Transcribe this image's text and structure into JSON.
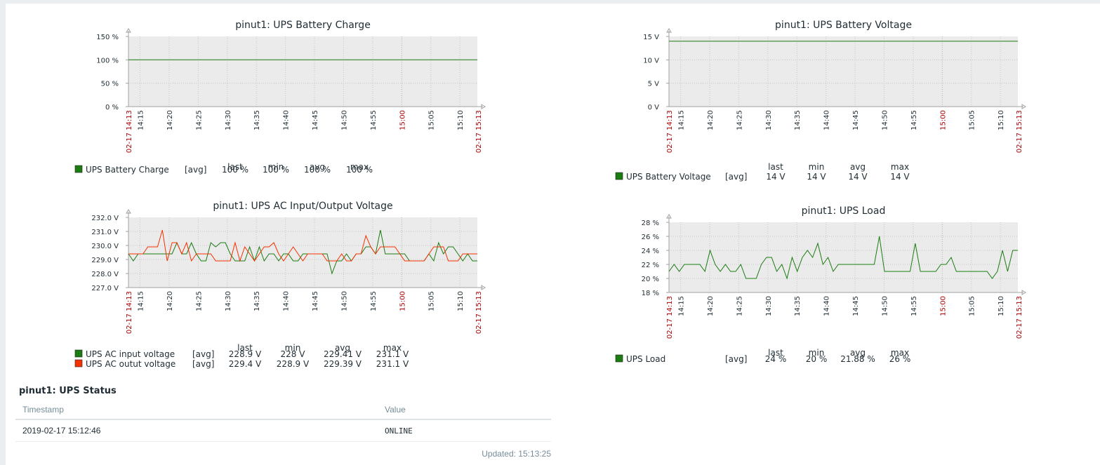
{
  "colors": {
    "plot_bg": "#ebebeb",
    "grid": "#c6c6c6",
    "axis": "#a0a0a0",
    "series_green": "#1a7c11",
    "series_red": "#f63100",
    "time_red": "#aa0000",
    "text": "#1f2c33"
  },
  "charts": [
    {
      "title": "pinut1: UPS Battery Charge",
      "legend_headers": [
        "last",
        "min",
        "avg",
        "max"
      ],
      "legend": [
        {
          "name": "UPS Battery Charge",
          "func": "[avg]",
          "color": "#1a7c11",
          "last": "100 %",
          "min": "100 %",
          "avg": "100 %",
          "max": "100 %"
        }
      ],
      "x_ticks": [
        "14:15",
        "14:20",
        "14:25",
        "14:30",
        "14:35",
        "14:40",
        "14:45",
        "14:50",
        "14:55",
        "15:00",
        "15:05",
        "15:10"
      ],
      "x_start_label": "02-17 14:13",
      "x_end_label": "02-17 15:13",
      "y_ticks": [
        "0 %",
        "50 %",
        "100 %",
        "150 %"
      ]
    },
    {
      "title": "pinut1: UPS Battery Voltage",
      "legend_headers": [
        "last",
        "min",
        "avg",
        "max"
      ],
      "legend": [
        {
          "name": "UPS Battery Voltage",
          "func": "[avg]",
          "color": "#1a7c11",
          "last": "14 V",
          "min": "14 V",
          "avg": "14 V",
          "max": "14 V"
        }
      ],
      "x_ticks": [
        "14:15",
        "14:20",
        "14:25",
        "14:30",
        "14:35",
        "14:40",
        "14:45",
        "14:50",
        "14:55",
        "15:00",
        "15:05",
        "15:10"
      ],
      "x_start_label": "02-17 14:13",
      "x_end_label": "02-17 15:13",
      "y_ticks": [
        "0 V",
        "5 V",
        "10 V",
        "15 V"
      ]
    },
    {
      "title": "pinut1: UPS AC Input/Output Voltage",
      "legend_headers": [
        "last",
        "min",
        "avg",
        "max"
      ],
      "legend": [
        {
          "name": "UPS AC input voltage",
          "func": "[avg]",
          "color": "#1a7c11",
          "last": "228.9 V",
          "min": "228 V",
          "avg": "229.41 V",
          "max": "231.1 V"
        },
        {
          "name": "UPS AC outut voltage",
          "func": "[avg]",
          "color": "#f63100",
          "last": "229.4 V",
          "min": "228.9 V",
          "avg": "229.39 V",
          "max": "231.1 V"
        }
      ],
      "x_ticks": [
        "14:15",
        "14:20",
        "14:25",
        "14:30",
        "14:35",
        "14:40",
        "14:45",
        "14:50",
        "14:55",
        "15:00",
        "15:05",
        "15:10"
      ],
      "x_start_label": "02-17 14:13",
      "x_end_label": "02-17 15:13",
      "y_ticks": [
        "227.0 V",
        "228.0 V",
        "229.0 V",
        "230.0 V",
        "231.0 V",
        "232.0 V"
      ]
    },
    {
      "title": "pinut1: UPS Load",
      "legend_headers": [
        "last",
        "min",
        "avg",
        "max"
      ],
      "legend": [
        {
          "name": "UPS Load",
          "func": "[avg]",
          "color": "#1a7c11",
          "last": "24 %",
          "min": "20 %",
          "avg": "21.88 %",
          "max": "26 %"
        }
      ],
      "x_ticks": [
        "14:15",
        "14:20",
        "14:25",
        "14:30",
        "14:35",
        "14:40",
        "14:45",
        "14:50",
        "14:55",
        "15:00",
        "15:05",
        "15:10"
      ],
      "x_start_label": "02-17 14:13",
      "x_end_label": "02-17 15:13",
      "y_ticks": [
        "18 %",
        "20 %",
        "22 %",
        "24 %",
        "26 %",
        "28 %"
      ]
    }
  ],
  "chart_data": [
    {
      "type": "line",
      "title": "pinut1: UPS Battery Charge",
      "ylim": [
        0,
        150
      ],
      "series": [
        {
          "name": "UPS Battery Charge",
          "values": [
            100,
            100
          ]
        }
      ],
      "x_range": [
        "14:13",
        "15:13"
      ]
    },
    {
      "type": "line",
      "title": "pinut1: UPS Battery Voltage",
      "ylim": [
        0,
        15
      ],
      "series": [
        {
          "name": "UPS Battery Voltage",
          "values": [
            14,
            14
          ]
        }
      ],
      "x_range": [
        "14:13",
        "15:13"
      ]
    },
    {
      "type": "line",
      "title": "pinut1: UPS AC Input/Output Voltage",
      "ylim": [
        227,
        232
      ],
      "x_range": [
        "14:13",
        "15:13"
      ],
      "series": [
        {
          "name": "UPS AC input voltage",
          "values": [
            229.4,
            228.9,
            229.4,
            229.4,
            229.4,
            229.4,
            229.4,
            229.4,
            229.4,
            229.4,
            230.2,
            229.4,
            229.4,
            230.2,
            229.4,
            228.9,
            228.9,
            230.2,
            229.9,
            230.2,
            230.2,
            229.4,
            228.9,
            228.9,
            228.9,
            229.9,
            228.9,
            229.9,
            228.9,
            229.4,
            229.4,
            228.9,
            229.4,
            229.4,
            228.9,
            228.9,
            229.4,
            229.4,
            229.4,
            229.4,
            229.4,
            229.4,
            228.0,
            228.9,
            228.9,
            229.4,
            228.9,
            229.4,
            229.4,
            229.9,
            229.9,
            229.4,
            231.1,
            229.4,
            229.4,
            229.4,
            229.4,
            229.4,
            228.9,
            228.9,
            228.9,
            228.9,
            229.4,
            228.9,
            230.2,
            229.4,
            229.9,
            229.9,
            229.4,
            228.9,
            229.4,
            228.9,
            228.9
          ]
        },
        {
          "name": "UPS AC outut voltage",
          "values": [
            229.4,
            229.4,
            229.4,
            229.4,
            229.9,
            229.9,
            229.9,
            231.1,
            228.9,
            230.2,
            230.2,
            229.4,
            230.2,
            228.9,
            229.4,
            229.4,
            229.4,
            229.4,
            228.9,
            228.9,
            228.9,
            228.9,
            230.2,
            228.9,
            229.9,
            229.4,
            228.9,
            229.4,
            229.9,
            229.9,
            230.2,
            229.4,
            228.9,
            229.4,
            229.9,
            229.4,
            228.9,
            229.4,
            229.4,
            229.4,
            229.4,
            228.9,
            228.9,
            228.9,
            229.4,
            228.9,
            228.9,
            229.4,
            229.4,
            230.7,
            229.9,
            229.4,
            229.9,
            229.9,
            229.9,
            229.9,
            229.4,
            228.9,
            228.9,
            228.9,
            228.9,
            228.9,
            229.4,
            229.9,
            229.9,
            229.9,
            228.9,
            228.9,
            228.9,
            229.4,
            229.4,
            229.4,
            229.4
          ]
        }
      ]
    },
    {
      "type": "line",
      "title": "pinut1: UPS Load",
      "ylim": [
        18,
        28
      ],
      "x_range": [
        "14:13",
        "15:13"
      ],
      "series": [
        {
          "name": "UPS Load",
          "values": [
            21,
            22,
            21,
            22,
            22,
            22,
            22,
            21,
            24,
            22,
            21,
            22,
            21,
            21,
            22,
            20,
            20,
            20,
            22,
            23,
            23,
            21,
            22,
            20,
            23,
            21,
            23,
            24,
            23,
            25,
            22,
            23,
            21,
            22,
            22,
            22,
            22,
            22,
            22,
            22,
            22,
            26,
            21,
            21,
            21,
            21,
            21,
            21,
            25,
            21,
            21,
            21,
            21,
            22,
            22,
            23,
            21,
            21,
            21,
            21,
            21,
            21,
            21,
            20,
            21,
            24,
            21,
            24,
            24
          ]
        }
      ]
    }
  ],
  "status": {
    "title": "pinut1: UPS Status",
    "col_timestamp": "Timestamp",
    "col_value": "Value",
    "rows": [
      {
        "timestamp": "2019-02-17 15:12:46",
        "value": "ONLINE"
      }
    ],
    "updated": "Updated: 15:13:25"
  }
}
